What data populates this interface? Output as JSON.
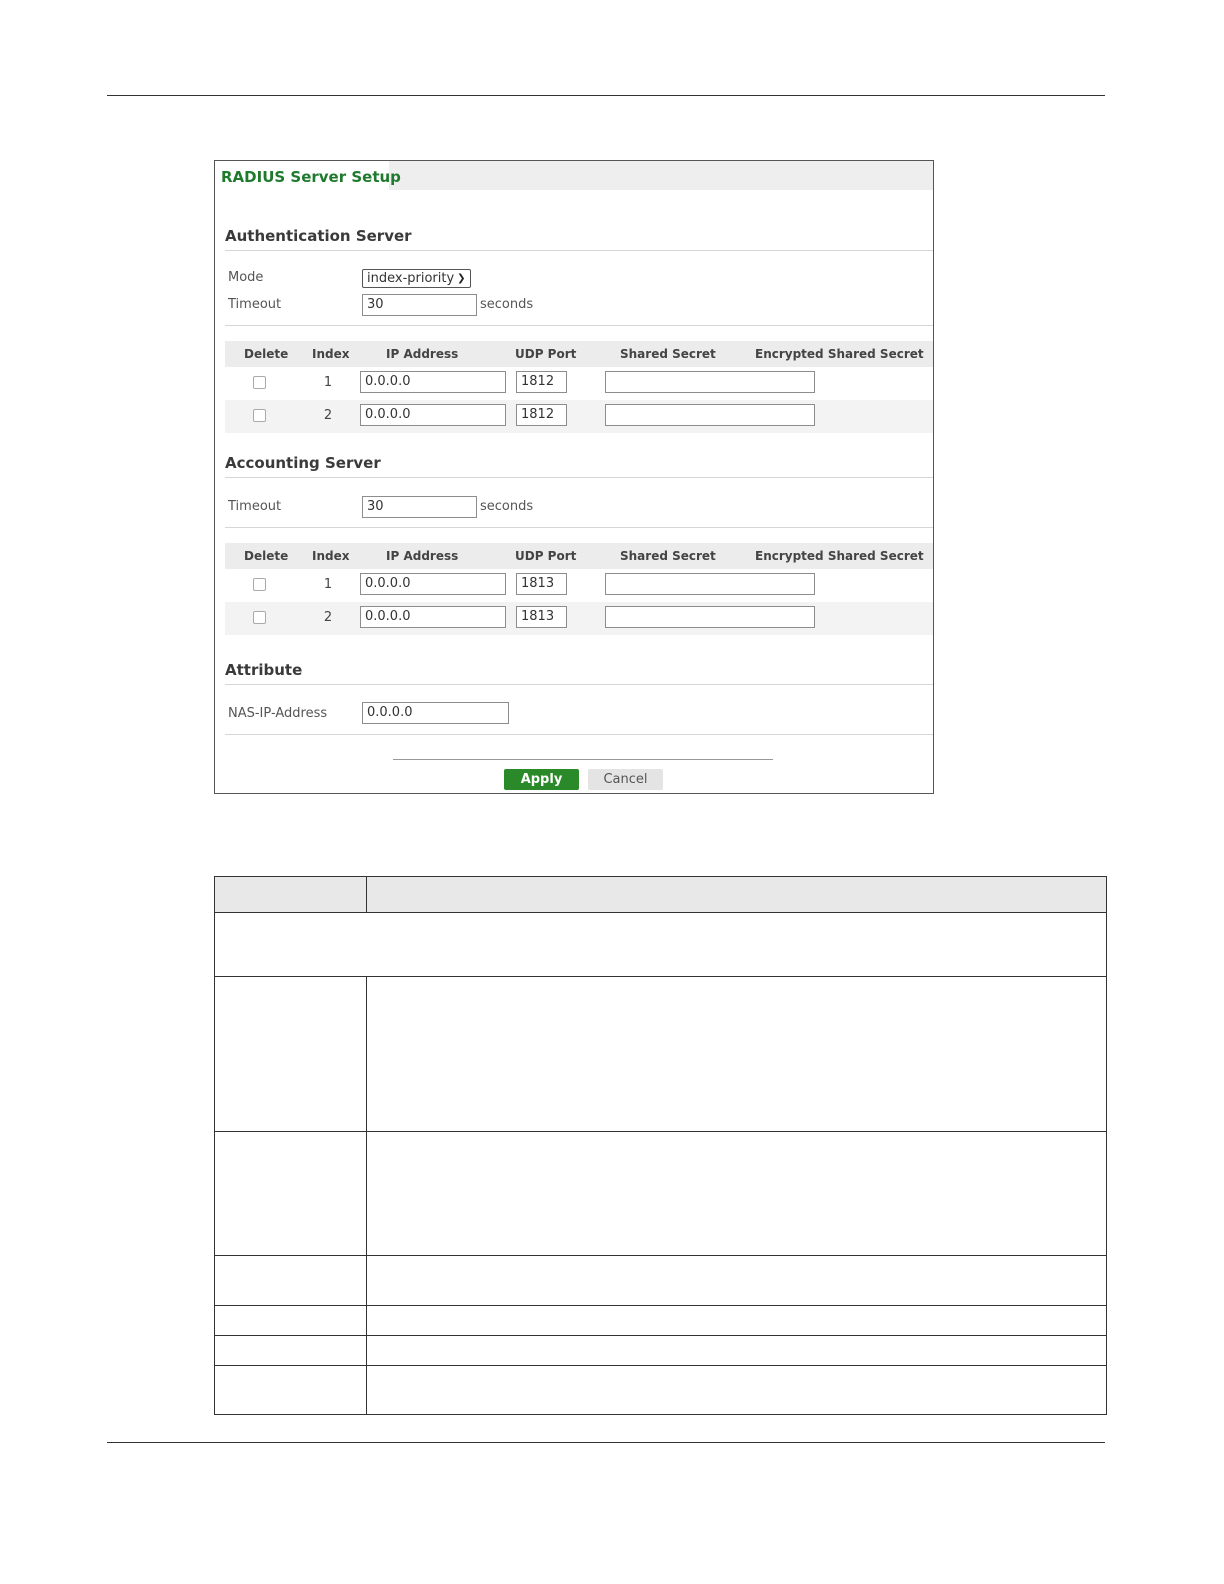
{
  "panel": {
    "tab_title": "RADIUS Server Setup"
  },
  "auth": {
    "title": "Authentication Server",
    "mode_label": "Mode",
    "mode_value": "index-priority",
    "timeout_label": "Timeout",
    "timeout_value": "30",
    "timeout_unit": "seconds",
    "columns": [
      "Delete",
      "Index",
      "IP Address",
      "UDP Port",
      "Shared Secret",
      "Encrypted Shared Secret"
    ],
    "rows": [
      {
        "index": "1",
        "ip": "0.0.0.0",
        "port": "1812",
        "secret": ""
      },
      {
        "index": "2",
        "ip": "0.0.0.0",
        "port": "1812",
        "secret": ""
      }
    ]
  },
  "acct": {
    "title": "Accounting Server",
    "timeout_label": "Timeout",
    "timeout_value": "30",
    "timeout_unit": "seconds",
    "columns": [
      "Delete",
      "Index",
      "IP Address",
      "UDP Port",
      "Shared Secret",
      "Encrypted Shared Secret"
    ],
    "rows": [
      {
        "index": "1",
        "ip": "0.0.0.0",
        "port": "1813",
        "secret": ""
      },
      {
        "index": "2",
        "ip": "0.0.0.0",
        "port": "1813",
        "secret": ""
      }
    ]
  },
  "attribute": {
    "title": "Attribute",
    "nas_label": "NAS-IP-Address",
    "nas_value": "0.0.0.0"
  },
  "buttons": {
    "apply": "Apply",
    "cancel": "Cancel"
  },
  "colors": {
    "tab_title": "#1f7a2e",
    "apply_button": "#2a8a2a"
  }
}
